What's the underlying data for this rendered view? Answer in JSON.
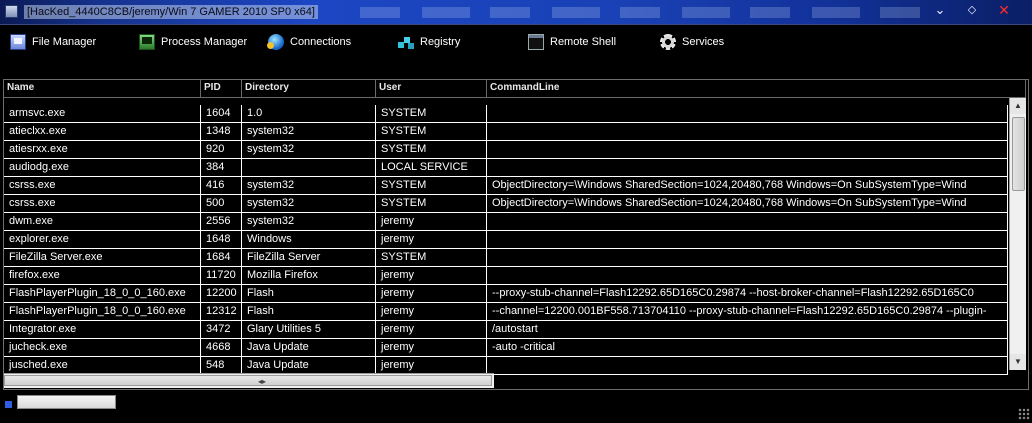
{
  "window": {
    "title": "[HacKed_4440C8CB/jeremy/Win 7 GAMER 2010 SP0 x64]",
    "controls": {
      "minimize": "⌄",
      "maximize": "◇",
      "close": "✕"
    }
  },
  "toolbar": {
    "items": [
      {
        "label": "File Manager",
        "icon": "file-manager-icon"
      },
      {
        "label": "Process Manager",
        "icon": "process-manager-icon"
      },
      {
        "label": "Connections",
        "icon": "globe-icon"
      },
      {
        "label": "Registry",
        "icon": "registry-icon"
      },
      {
        "label": "Remote Shell",
        "icon": "terminal-icon"
      },
      {
        "label": "Services",
        "icon": "gear-icon"
      }
    ]
  },
  "table": {
    "columns": [
      "Name",
      "PID",
      "Directory",
      "User",
      "CommandLine"
    ],
    "rows": [
      [
        "armsvc.exe",
        "1604",
        "1.0",
        "SYSTEM",
        ""
      ],
      [
        "atieclxx.exe",
        "1348",
        "system32",
        "SYSTEM",
        ""
      ],
      [
        "atiesrxx.exe",
        "920",
        "system32",
        "SYSTEM",
        ""
      ],
      [
        "audiodg.exe",
        "384",
        "",
        "LOCAL SERVICE",
        ""
      ],
      [
        "csrss.exe",
        "416",
        "system32",
        "SYSTEM",
        "ObjectDirectory=\\Windows SharedSection=1024,20480,768 Windows=On SubSystemType=Wind"
      ],
      [
        "csrss.exe",
        "500",
        "system32",
        "SYSTEM",
        "ObjectDirectory=\\Windows SharedSection=1024,20480,768 Windows=On SubSystemType=Wind"
      ],
      [
        "dwm.exe",
        "2556",
        "system32",
        "jeremy",
        ""
      ],
      [
        "explorer.exe",
        "1648",
        "Windows",
        "jeremy",
        ""
      ],
      [
        "FileZilla Server.exe",
        "1684",
        "FileZilla Server",
        "SYSTEM",
        ""
      ],
      [
        "firefox.exe",
        "11720",
        "Mozilla Firefox",
        "jeremy",
        ""
      ],
      [
        "FlashPlayerPlugin_18_0_0_160.exe",
        "12200",
        "Flash",
        "jeremy",
        "--proxy-stub-channel=Flash12292.65D165C0.29874 --host-broker-channel=Flash12292.65D165C0"
      ],
      [
        "FlashPlayerPlugin_18_0_0_160.exe",
        "12312",
        "Flash",
        "jeremy",
        "--channel=12200.001BF558.713704110 --proxy-stub-channel=Flash12292.65D165C0.29874 --plugin-"
      ],
      [
        "Integrator.exe",
        "3472",
        "Glary Utilities 5",
        "jeremy",
        "/autostart"
      ],
      [
        "jucheck.exe",
        "4668",
        "Java Update",
        "jeremy",
        "-auto -critical"
      ],
      [
        "jusched.exe",
        "548",
        "Java Update",
        "jeremy",
        ""
      ]
    ]
  },
  "scrollbars": {
    "vertical": {
      "up_arrow": "▲",
      "down_arrow": "▼"
    },
    "horizontal": {
      "grip": "◂▸"
    }
  }
}
